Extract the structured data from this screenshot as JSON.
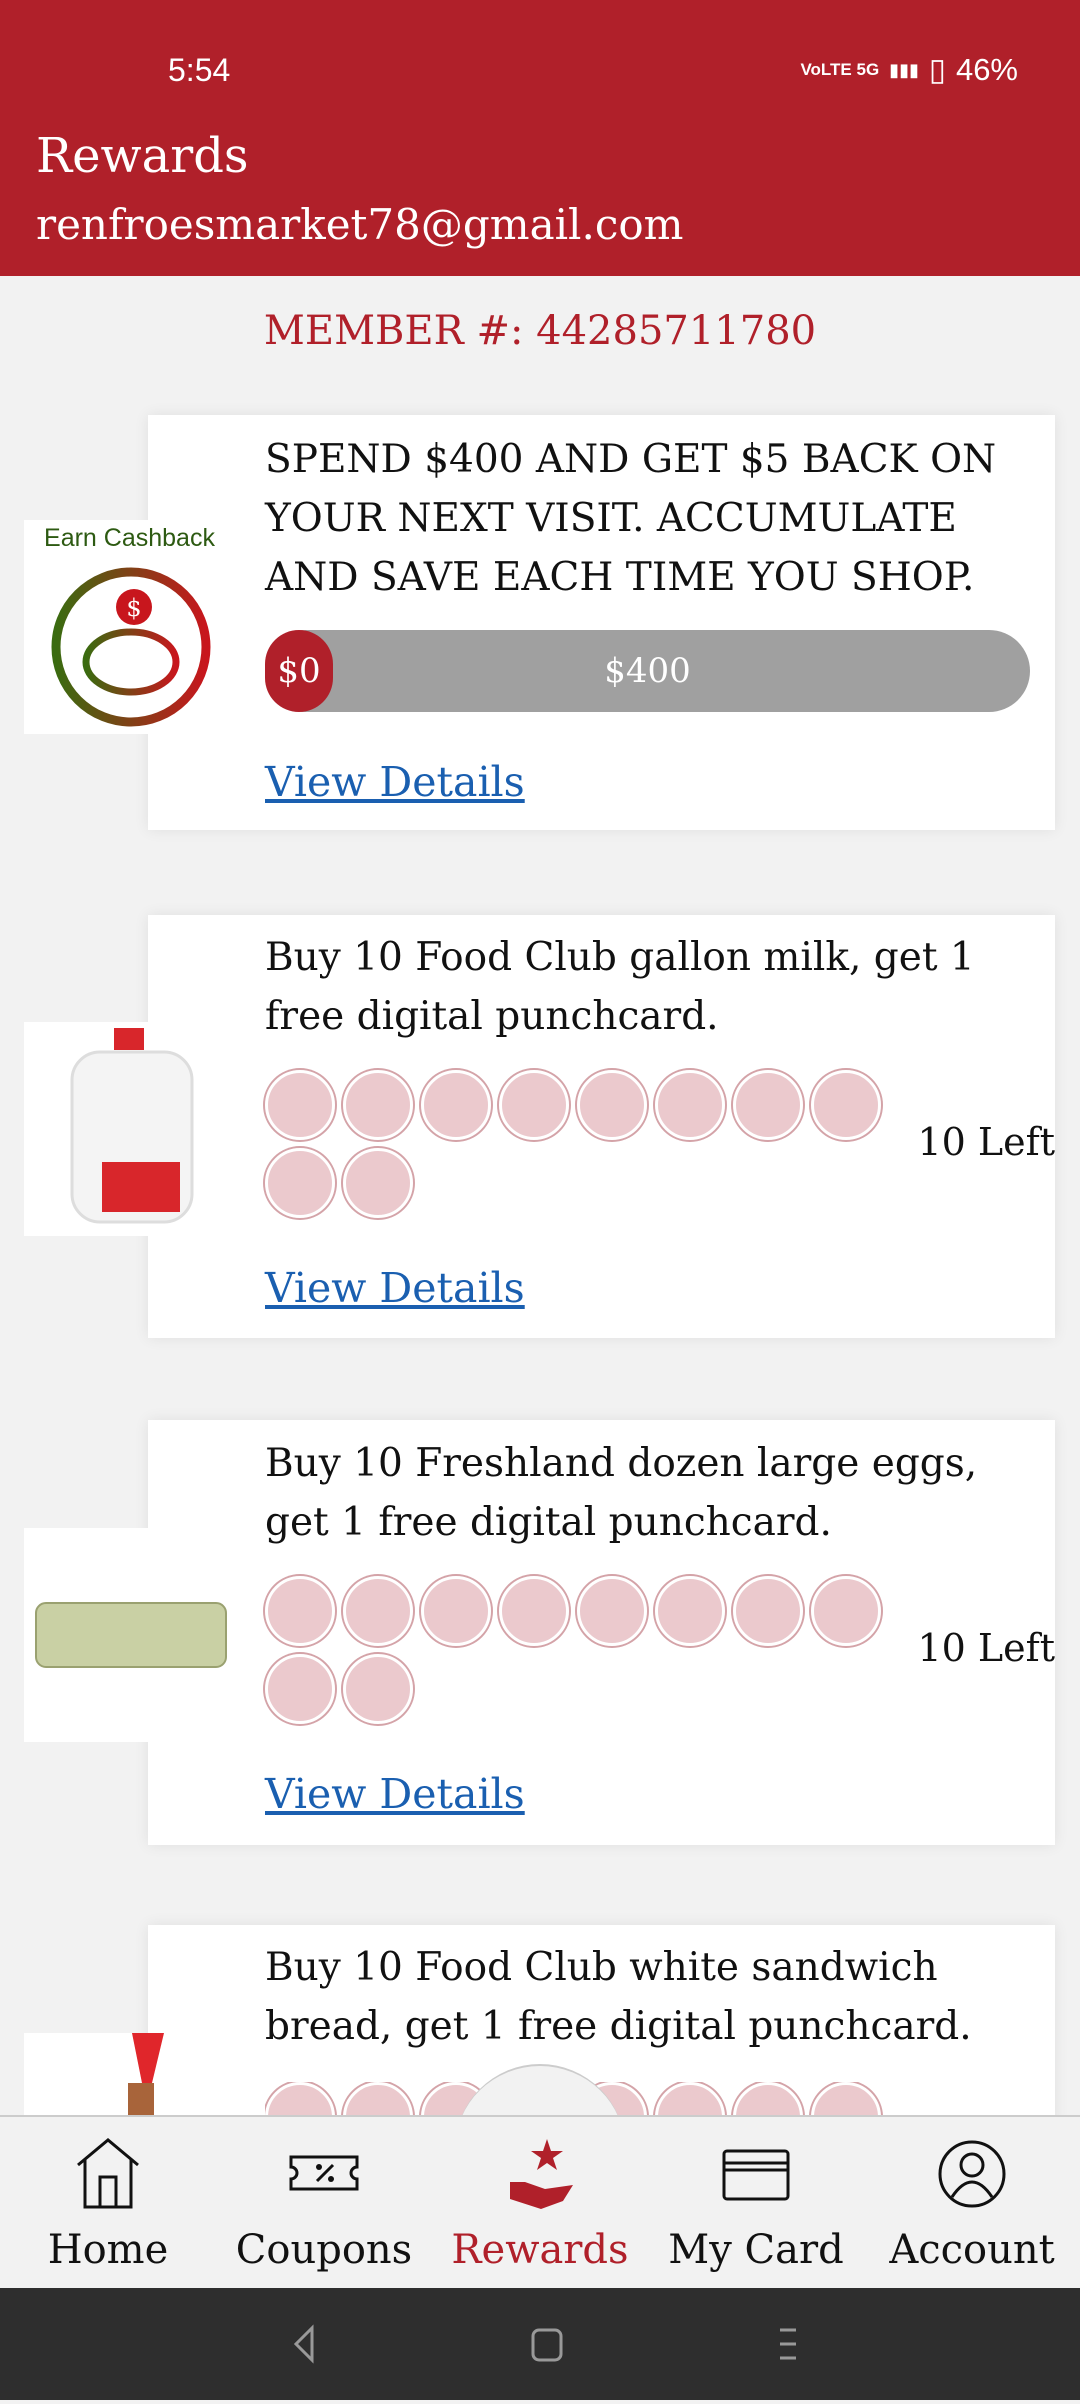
{
  "status_bar": {
    "time": "5:54",
    "network": "VoLTE 5G",
    "battery": "46%"
  },
  "header": {
    "title": "Rewards",
    "email": "renfroesmarket78@gmail.com"
  },
  "member": {
    "label": "MEMBER #: 44285711780"
  },
  "cashback": {
    "image_label": "Earn Cashback",
    "description": "SPEND $400 AND GET $5 BACK ON YOUR NEXT VISIT. ACCUMULATE AND SAVE EACH TIME YOU SHOP.",
    "progress_current": "$0",
    "progress_goal": "$400",
    "progress_fraction": 0,
    "link": "View Details"
  },
  "punchcards": [
    {
      "description": "Buy 10 Food Club gallon milk, get 1 free digital punchcard.",
      "remaining": "10 Left",
      "punches_total": 10,
      "punches_used": 0,
      "link": "View Details",
      "image": "milk-gallon"
    },
    {
      "description": "Buy 10 Freshland dozen large eggs, get 1 free digital punchcard.",
      "remaining": "10 Left",
      "punches_total": 10,
      "punches_used": 0,
      "link": "View Details",
      "image": "egg-carton"
    },
    {
      "description": "Buy 10 Food Club white sandwich bread, get 1 free digital punchcard.",
      "image": "bread-loaf"
    }
  ],
  "nav": {
    "items": [
      {
        "label": "Home"
      },
      {
        "label": "Coupons"
      },
      {
        "label": "Rewards"
      },
      {
        "label": "My Card"
      },
      {
        "label": "Account"
      }
    ],
    "active": "Rewards"
  },
  "colors": {
    "brand": "#b0202a",
    "link": "#1a5fb0"
  }
}
